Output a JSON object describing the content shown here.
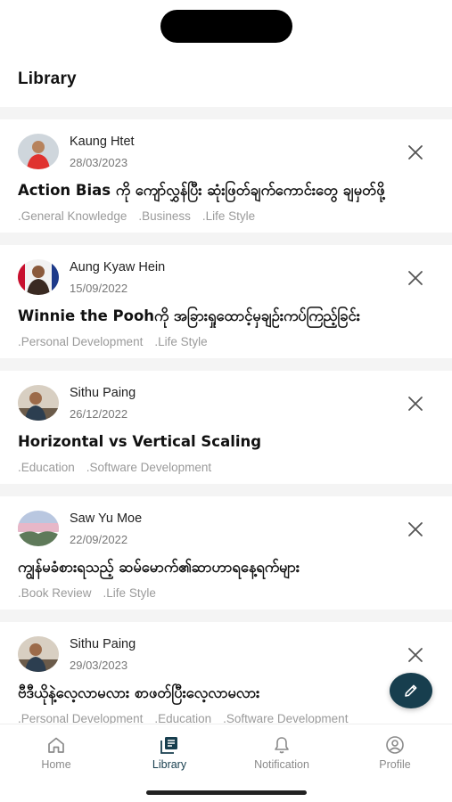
{
  "header": {
    "title": "Library"
  },
  "posts": [
    {
      "author": "Kaung Htet",
      "date": "28/03/2023",
      "title": "Action Bias ကို ကျော်လွှန်ပြီး ဆုံးဖြတ်ချက်ကောင်းတွေ ချမှတ်ဖို့",
      "tags": [
        ".General Knowledge",
        ".Business",
        ".Life Style"
      ]
    },
    {
      "author": "Aung Kyaw Hein",
      "date": "15/09/2022",
      "title": "Winnie the Poohကို အခြားရှုထောင့်မှချဉ်းကပ်ကြည့်ခြင်း",
      "tags": [
        ".Personal Development",
        ".Life Style"
      ]
    },
    {
      "author": "Sithu Paing",
      "date": "26/12/2022",
      "title": "Horizontal vs Vertical Scaling",
      "tags": [
        ".Education",
        ".Software Development"
      ]
    },
    {
      "author": "Saw Yu Moe",
      "date": "22/09/2022",
      "title": "ကျွန်မခံစားရသည့် ဆမ်မောက်၏ဆာဟာရနေ့ရက်များ",
      "tags": [
        ".Book Review",
        ".Life Style"
      ]
    },
    {
      "author": "Sithu Paing",
      "date": "29/03/2023",
      "title": "ဗီဒီယိုနဲ့လေ့လာမလား စာဖတ်ပြီးလေ့လာမလား",
      "tags": [
        ".Personal Development",
        ".Education",
        ".Software Development"
      ]
    }
  ],
  "nav": {
    "home": "Home",
    "library": "Library",
    "notification": "Notification",
    "profile": "Profile"
  },
  "icons": {
    "close": "close-icon",
    "fab": "pencil-icon",
    "home": "home-icon",
    "library": "library-icon",
    "notification": "bell-icon",
    "profile": "profile-icon"
  },
  "colors": {
    "accent": "#173e4e",
    "muted": "#8a8a8a",
    "tag": "#9a9a9a",
    "separator": "#f4f4f4"
  }
}
